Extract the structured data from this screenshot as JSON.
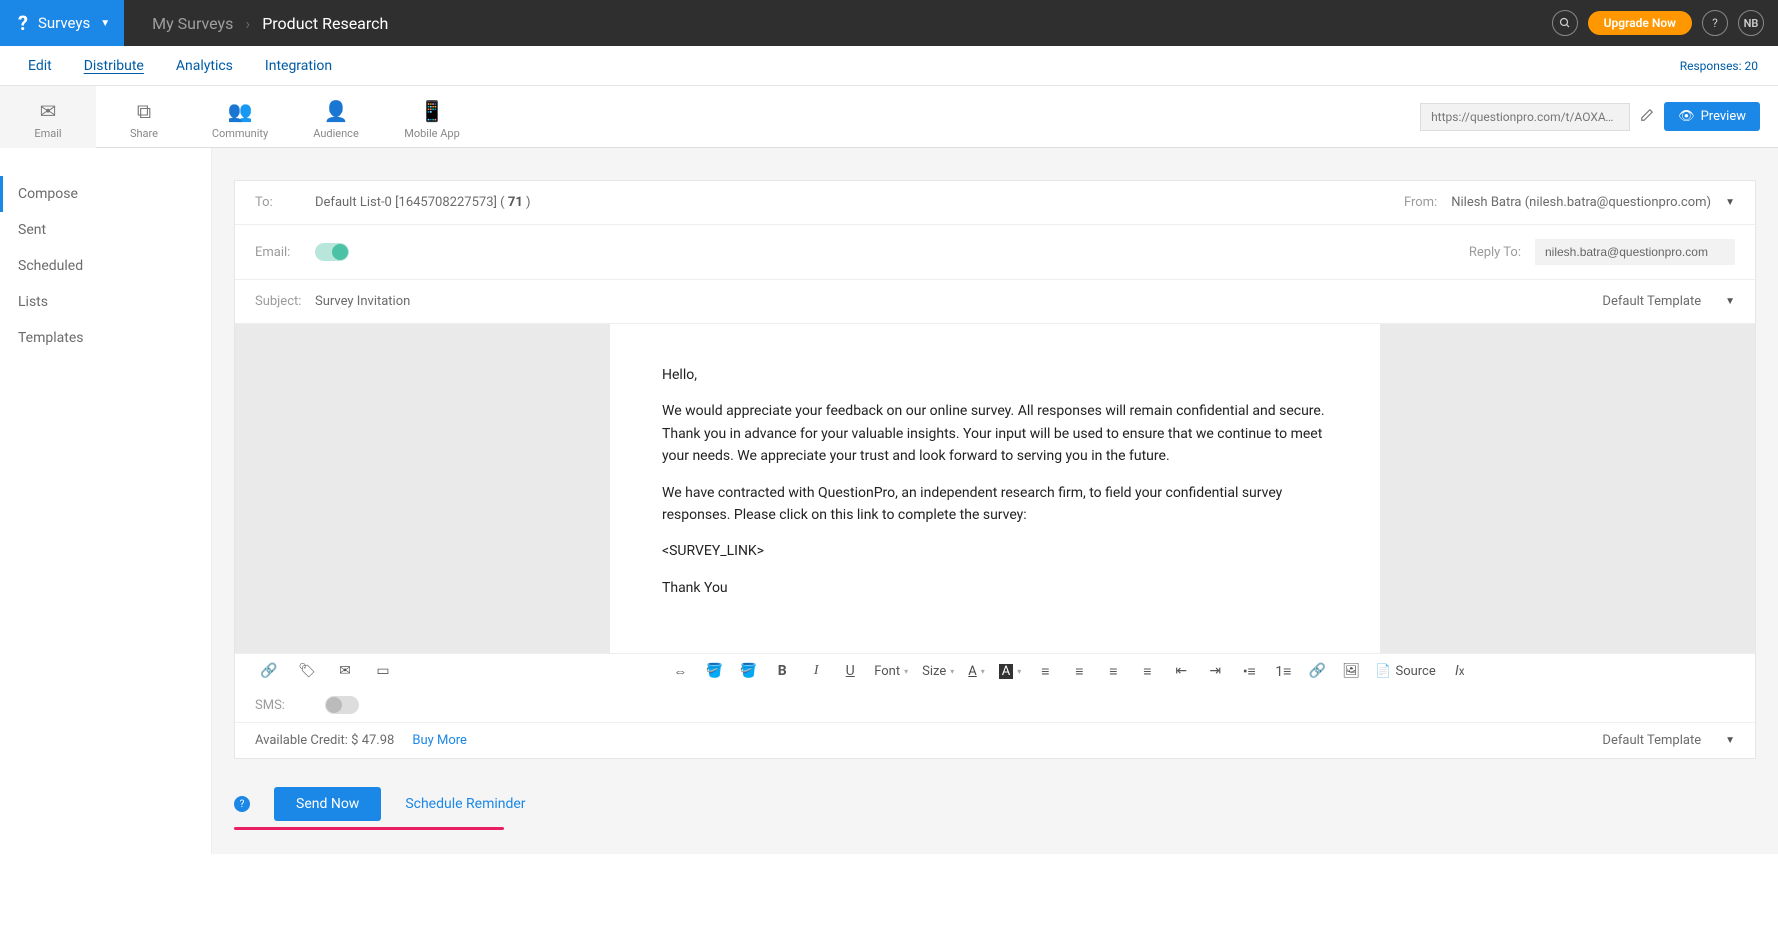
{
  "brand": {
    "label": "Surveys"
  },
  "breadcrumb": {
    "parent": "My Surveys",
    "current": "Product Research"
  },
  "header": {
    "upgrade": "Upgrade Now",
    "avatar": "NB"
  },
  "subtabs": {
    "edit": "Edit",
    "distribute": "Distribute",
    "analytics": "Analytics",
    "integration": "Integration",
    "responses": "Responses: 20"
  },
  "distToolbar": {
    "email": "Email",
    "share": "Share",
    "community": "Community",
    "audience": "Audience",
    "mobile": "Mobile App",
    "url": "https://questionpro.com/t/AOXAyZrIjI",
    "preview": "Preview"
  },
  "sidebar": {
    "compose": "Compose",
    "sent": "Sent",
    "scheduled": "Scheduled",
    "lists": "Lists",
    "templates": "Templates"
  },
  "compose": {
    "toLabel": "To:",
    "toValue": "Default List-0 [1645708227573] (",
    "toCount": "71",
    "toClose": " )",
    "fromLabel": "From:",
    "fromValue": "Nilesh Batra (nilesh.batra@questionpro.com)",
    "emailLabel": "Email:",
    "replyToLabel": "Reply To:",
    "replyToValue": "nilesh.batra@questionpro.com",
    "subjectLabel": "Subject:",
    "subjectValue": "Survey Invitation",
    "templateDd": "Default Template",
    "body": {
      "greeting": "Hello,",
      "p1": "We would appreciate your feedback on our online survey. All responses will remain confidential and secure. Thank you in advance for your valuable insights. Your input will be used to ensure that we continue to meet your needs. We appreciate your trust and look forward to serving you in the future.",
      "p2": "We have contracted with QuestionPro, an independent research firm, to field your confidential survey responses. Please click on this link to complete the survey:",
      "link": "<SURVEY_LINK>",
      "signoff": "Thank You"
    },
    "smsLabel": "SMS:",
    "creditLabel": "Available Credit: $ 47.98",
    "buyMore": "Buy More",
    "templateDd2": "Default Template",
    "sourceLabel": "Source",
    "fontLabel": "Font",
    "sizeLabel": "Size"
  },
  "actions": {
    "sendNow": "Send Now",
    "schedule": "Schedule Reminder"
  }
}
